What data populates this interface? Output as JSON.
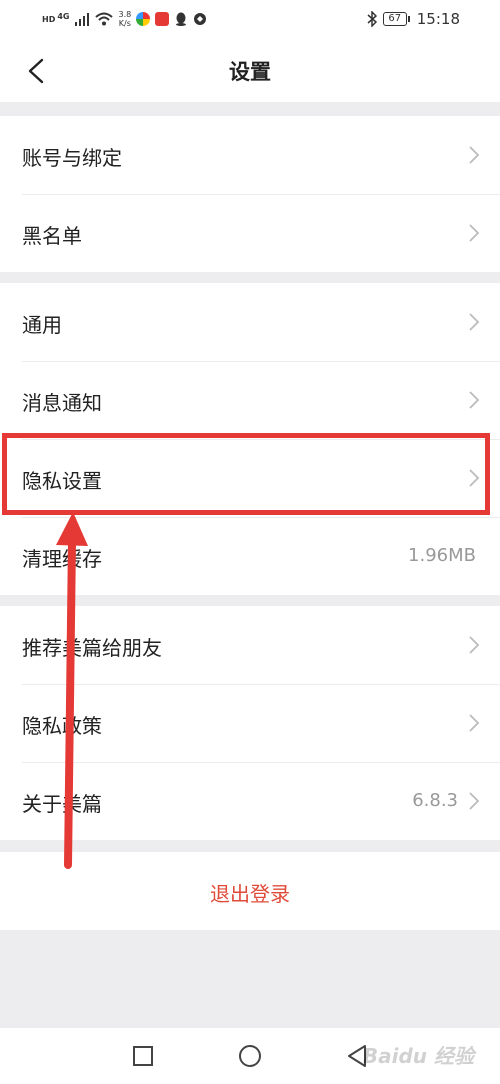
{
  "status_bar": {
    "network_label": "HD",
    "signal_label": "4G",
    "speed_value": "3.8",
    "speed_unit": "K/s",
    "battery": "67",
    "time": "15:18"
  },
  "header": {
    "title": "设置"
  },
  "groups": [
    {
      "items": [
        {
          "label": "账号与绑定"
        },
        {
          "label": "黑名单"
        }
      ]
    },
    {
      "items": [
        {
          "label": "通用"
        },
        {
          "label": "消息通知"
        },
        {
          "label": "隐私设置"
        },
        {
          "label": "清理缓存",
          "value": "1.96MB"
        }
      ]
    },
    {
      "items": [
        {
          "label": "推荐美篇给朋友"
        },
        {
          "label": "隐私政策"
        },
        {
          "label": "关于美篇",
          "value": "6.8.3"
        }
      ]
    }
  ],
  "logout_label": "退出登录",
  "annotation": {
    "color": "#e53935"
  },
  "watermark": "Baidu 经验",
  "colors": {
    "accent_red": "#e04b3a",
    "background": "#ededf0"
  }
}
